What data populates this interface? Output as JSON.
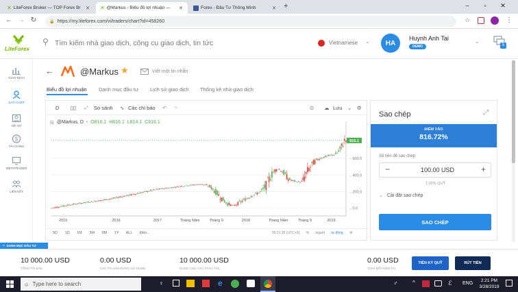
{
  "browser": {
    "tabs": [
      {
        "title": "LiteForex Broker — TOP Forex Br",
        "active": false
      },
      {
        "title": "@Markus - Biểu đồ lợi nhuận —",
        "active": true
      },
      {
        "title": "Forex - Đầu Tư Thông Minh",
        "active": false
      }
    ],
    "new_tab": "+",
    "window_controls": {
      "minimize": "–",
      "maximize": "▫",
      "close": "✕"
    },
    "url": "https://my.liteforex.com/vi/traders/chart?id=458260"
  },
  "header": {
    "logo": "LiteForex",
    "search_placeholder": "Tìm kiếm nhà giao dịch, công cụ giao dịch, tin tức",
    "language": "Vietnamese",
    "avatar_initials": "HA",
    "user_name": "Huynh Anh Tai",
    "account_badge": "DEMO",
    "notification_count": "5"
  },
  "left_nav": [
    {
      "label": "GIAO DỊCH",
      "icon": "chart-icon"
    },
    {
      "label": "SAO CHÉP",
      "icon": "copy-user-icon"
    },
    {
      "label": "HỒ SƠ",
      "icon": "profile-icon"
    },
    {
      "label": "TÀI CHÍNH",
      "icon": "dollar-icon"
    },
    {
      "label": "METATRADER",
      "icon": "monitor-icon"
    },
    {
      "label": "LIÊN KẾT",
      "icon": "partners-icon"
    }
  ],
  "trader": {
    "name": "@Markus",
    "message_label": "Viết một tin nhắn",
    "tabs": [
      "Biểu đồ lợi nhuận",
      "Danh mục đầu tư",
      "Lịch sử giao dịch",
      "Thống kê nhà giao dịch"
    ]
  },
  "chart_toolbar": {
    "interval": "D",
    "compare": "So sánh",
    "indicators": "Các chỉ báo",
    "save": "Lưu"
  },
  "chart_data": {
    "type": "candlestick",
    "symbol": "@Markus, D",
    "ohlc_labels": {
      "O": "O816.1",
      "H": "H816.1",
      "L": "L814.1",
      "C": "C816.1"
    },
    "last_price_label": "816.1",
    "y_ticks": [
      0.0,
      200.0,
      400.0,
      600.0
    ],
    "ylim": [
      -60,
      980
    ],
    "x_ticks": [
      "2015",
      "2016",
      "2017",
      "Tháng Năm",
      "Tháng 9",
      "2018",
      "Tháng Năm",
      "Tháng 9",
      "2019"
    ],
    "x_tick_pos": [
      0.04,
      0.22,
      0.36,
      0.47,
      0.56,
      0.66,
      0.77,
      0.86,
      0.95
    ],
    "series": {
      "t": [
        0,
        0.03,
        0.06,
        0.09,
        0.12,
        0.15,
        0.18,
        0.21,
        0.24,
        0.27,
        0.3,
        0.33,
        0.36,
        0.39,
        0.42,
        0.45,
        0.48,
        0.51,
        0.54,
        0.56,
        0.58,
        0.6,
        0.62,
        0.64,
        0.66,
        0.68,
        0.7,
        0.715,
        0.73,
        0.745,
        0.76,
        0.775,
        0.79,
        0.805,
        0.82,
        0.835,
        0.85,
        0.87,
        0.89,
        0.91,
        0.93,
        0.95,
        0.965,
        0.98,
        0.995
      ],
      "v": [
        0,
        20,
        40,
        55,
        70,
        85,
        100,
        118,
        140,
        160,
        185,
        205,
        228,
        240,
        255,
        268,
        280,
        290,
        260,
        190,
        110,
        50,
        30,
        70,
        110,
        150,
        180,
        210,
        280,
        390,
        460,
        470,
        420,
        350,
        330,
        320,
        310,
        450,
        550,
        600,
        620,
        640,
        650,
        700,
        816
      ]
    }
  },
  "timeframes": [
    "5D",
    "1D",
    "1M",
    "3M",
    "6M",
    "1Y",
    "ALL",
    "Đến..."
  ],
  "chart_footer": {
    "time": "09:21:25 (UTC+3)",
    "percent": "%",
    "log": "logarit",
    "auto": "tự động"
  },
  "copy_panel": {
    "title": "Sao chép",
    "entry_label": "ĐIỂM VÀO",
    "entry_value": "816.72%",
    "amount_label": "Số tiền để sao chép",
    "amount_value": "100.00 USD",
    "min_label": "1.00% QUỸ",
    "settings_label": "Cài đặt sao chép",
    "copy_button": "SAO CHÉP"
  },
  "bottom_strip": {
    "label": "DANH MỤC ĐẦU TƯ"
  },
  "bottom_bar": {
    "total_assets": "10 000.00 USD",
    "total_assets_label": "TỔNG TÀI SẢN",
    "used_margin": "0.00 USD",
    "used_margin_label": "CÁC TÀI SẢN ĐƯỢC SỬ DỤNG",
    "free_margin": "10 000.00 USD",
    "free_margin_label": "DÙNG CHO CÁC THAO TÁC",
    "pnl": "0.00 USD",
    "pnl_label": "THAY ĐỔI HIỆN TẠI",
    "deposit_button": "TIỀN KÝ QUỸ",
    "withdraw_button": "RÚT TIỀN"
  },
  "taskbar": {
    "search_placeholder": "Type here to search",
    "language": "ENG",
    "time": "2:21 PM",
    "date": "3/28/2019"
  },
  "colors": {
    "accent": "#2b8ce6",
    "entry_blue": "#2d7fd8",
    "orange": "#ff6a13",
    "up_candle": "#4caf50",
    "down_candle": "#e53935",
    "star": "#f5a623",
    "deposit": "#1e63c8",
    "withdraw": "#0e2a55",
    "taskbar": "#1c1c2b"
  }
}
